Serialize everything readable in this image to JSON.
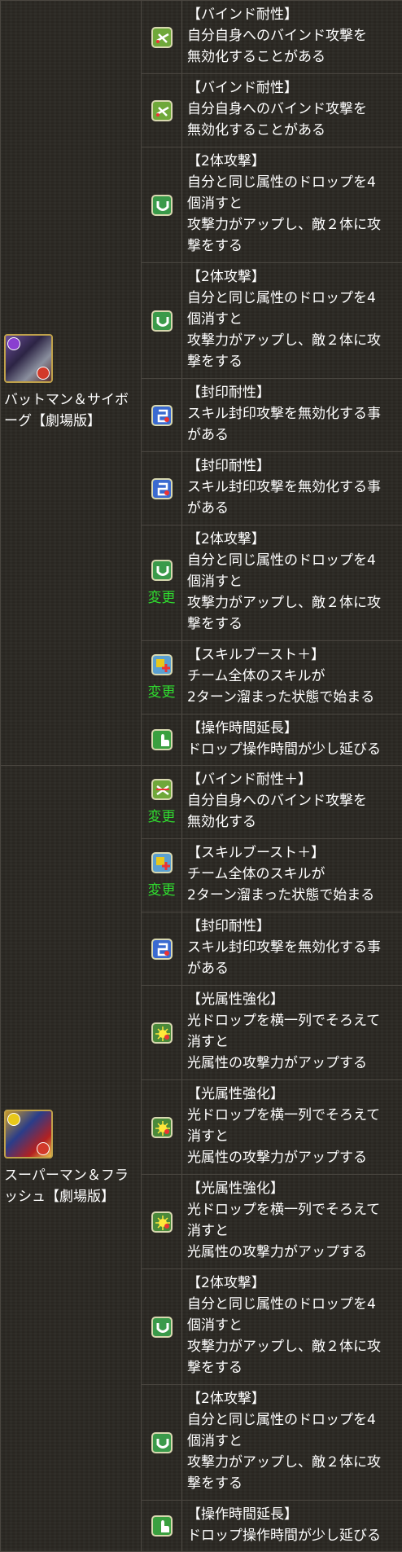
{
  "characters": [
    {
      "name": "バットマン＆サイボーグ【劇場版】"
    },
    {
      "name": "スーパーマン＆フラッシュ【劇場版】"
    }
  ],
  "change_label": "変更",
  "rows": [
    {
      "icon": "bind-resist-icon",
      "title": "【バインド耐性】",
      "lines": [
        "自分自身へのバインド攻撃を",
        "無効化することがある"
      ]
    },
    {
      "icon": "bind-resist-icon",
      "title": "【バインド耐性】",
      "lines": [
        "自分自身へのバインド攻撃を",
        "無効化することがある"
      ]
    },
    {
      "icon": "two-target-attack-icon",
      "title": "【2体攻撃】",
      "lines": [
        "自分と同じ属性のドロップを4",
        "個消すと",
        "攻撃力がアップし、敵２体に攻",
        "撃をする"
      ]
    },
    {
      "icon": "two-target-attack-icon",
      "title": "【2体攻撃】",
      "lines": [
        "自分と同じ属性のドロップを4",
        "個消すと",
        "攻撃力がアップし、敵２体に攻",
        "撃をする"
      ]
    },
    {
      "icon": "skill-bind-resist-icon",
      "title": "【封印耐性】",
      "lines": [
        "スキル封印攻撃を無効化する事",
        "がある"
      ]
    },
    {
      "icon": "skill-bind-resist-icon",
      "title": "【封印耐性】",
      "lines": [
        "スキル封印攻撃を無効化する事",
        "がある"
      ]
    },
    {
      "icon": "two-target-attack-icon",
      "title": "【2体攻撃】",
      "lines": [
        "自分と同じ属性のドロップを4",
        "個消すと",
        "攻撃力がアップし、敵２体に攻",
        "撃をする"
      ]
    },
    {
      "icon": "skill-boost-plus-icon",
      "title": "【スキルブースト＋】",
      "lines": [
        "チーム全体のスキルが",
        "2ターン溜まった状態で始まる"
      ]
    },
    {
      "icon": "time-extend-icon",
      "title": "【操作時間延長】",
      "lines": [
        "ドロップ操作時間が少し延びる"
      ]
    },
    {
      "icon": "bind-resist-plus-icon",
      "title": "【バインド耐性＋】",
      "lines": [
        "自分自身へのバインド攻撃を",
        "無効化する"
      ]
    },
    {
      "icon": "skill-boost-plus-icon",
      "title": "【スキルブースト＋】",
      "lines": [
        "チーム全体のスキルが",
        "2ターン溜まった状態で始まる"
      ]
    },
    {
      "icon": "skill-bind-resist-icon",
      "title": "【封印耐性】",
      "lines": [
        "スキル封印攻撃を無効化する事",
        "がある"
      ]
    },
    {
      "icon": "light-row-enhance-icon",
      "title": "【光属性強化】",
      "lines": [
        "光ドロップを横一列でそろえて",
        "消すと",
        "光属性の攻撃力がアップする"
      ]
    },
    {
      "icon": "light-row-enhance-icon",
      "title": "【光属性強化】",
      "lines": [
        "光ドロップを横一列でそろえて",
        "消すと",
        "光属性の攻撃力がアップする"
      ]
    },
    {
      "icon": "light-row-enhance-icon",
      "title": "【光属性強化】",
      "lines": [
        "光ドロップを横一列でそろえて",
        "消すと",
        "光属性の攻撃力がアップする"
      ]
    },
    {
      "icon": "two-target-attack-icon",
      "title": "【2体攻撃】",
      "lines": [
        "自分と同じ属性のドロップを4",
        "個消すと",
        "攻撃力がアップし、敵２体に攻",
        "撃をする"
      ]
    },
    {
      "icon": "two-target-attack-icon",
      "title": "【2体攻撃】",
      "lines": [
        "自分と同じ属性のドロップを4",
        "個消すと",
        "攻撃力がアップし、敵２体に攻",
        "撃をする"
      ]
    },
    {
      "icon": "time-extend-icon",
      "title": "【操作時間延長】",
      "lines": [
        "ドロップ操作時間が少し延びる"
      ]
    }
  ]
}
